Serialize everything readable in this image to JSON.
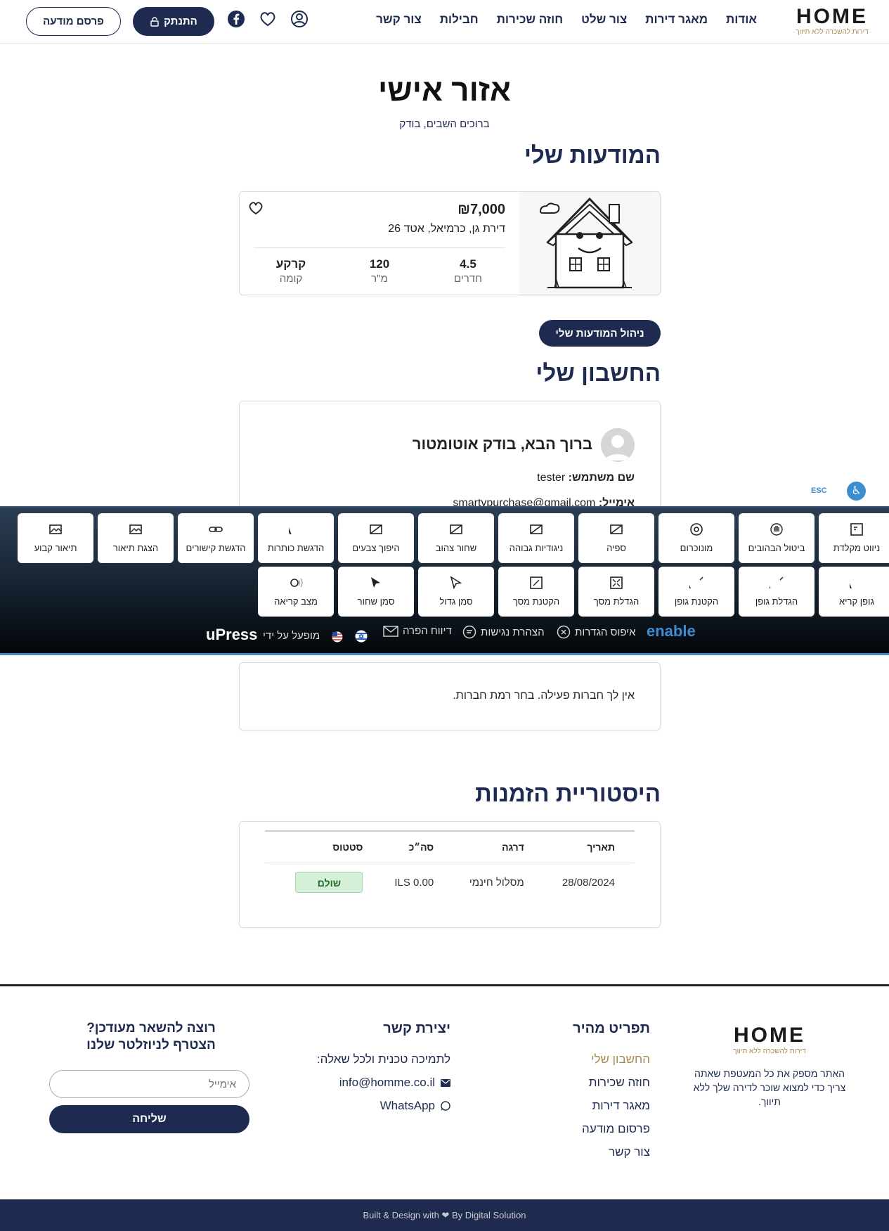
{
  "header": {
    "logo": "HOME",
    "logo_tagline": "דירות להשכרה ללא תיווך",
    "nav": [
      "אודות",
      "מאגר דירות",
      "צור שלט",
      "חוזה שכירות",
      "חבילות",
      "צור קשר"
    ],
    "login_label": "התנתק",
    "publish_label": "פרסם מודעה"
  },
  "page": {
    "title": "אזור אישי",
    "welcome": "ברוכים השבים, בודק"
  },
  "listings": {
    "title": "המודעות שלי",
    "item": {
      "price": "₪7,000",
      "address": "דירת גן, כרמיאל, אטד 26",
      "rooms_value": "4.5",
      "rooms_label": "חדרים",
      "size_value": "120",
      "size_label": "מ\"ר",
      "floor_value": "קרקע",
      "floor_label": "קומה"
    },
    "manage_label": "ניהול המודעות שלי"
  },
  "account": {
    "title": "החשבון שלי",
    "greeting": "ברוך הבא, בודק אוטומטור",
    "username_label": "שם משתמש:",
    "username": "tester",
    "email_label": "אימייל:",
    "email": "smartypurchase@gmail.com"
  },
  "membership": {
    "text": "אין לך חברות פעילה. בחר רמת חברות."
  },
  "orders": {
    "title": "היסטוריית הזמנות",
    "headers": [
      "תאריך",
      "דרגה",
      "סה״כ",
      "סטטוס"
    ],
    "rows": [
      {
        "date": "28/08/2024",
        "level": "מסלול חינמי",
        "total": "ILS 0.00",
        "status": "שולם"
      }
    ]
  },
  "accessibility": {
    "row1": [
      "ניווט מקלדת",
      "ביטול הבהובים",
      "מונוכרום",
      "ספיה",
      "ניגודיות גבוהה",
      "שחור צהוב",
      "היפוך צבעים",
      "הדגשת כותרות",
      "הדגשת קישורים",
      "הצגת תיאור",
      "תיאור קבוע"
    ],
    "row2": [
      "גופן קריא",
      "הגדלת גופן",
      "הקטנת גופן",
      "הגדלת מסך",
      "הקטנת מסך",
      "סמן גדול",
      "סמן שחור",
      "מצב קריאה"
    ],
    "brand": "enable",
    "reset": "איפוס הגדרות",
    "statement": "הצהרת נגישות",
    "report": "דיווח הפרה",
    "powered": "מופעל על ידי",
    "powered_brand": "uPress",
    "esc": "ESC"
  },
  "footer": {
    "logo": "HOME",
    "logo_tagline": "דירות להשכרה ללא תיווך",
    "about": "האתר מספק את כל המעטפת שאתה צריך כדי למצוא שוכר לדירה שלך ללא תיווך.",
    "quick_title": "תפריט מהיר",
    "quick_links": [
      "החשבון שלי",
      "חוזה שכירות",
      "מאגר דירות",
      "פרסום מודעה",
      "צור קשר"
    ],
    "contact_title": "יצירת קשר",
    "contact_support": "לתמיכה טכנית ולכל שאלה:",
    "contact_email": "info@homme.co.il",
    "contact_whatsapp": "WhatsApp",
    "newsletter_title_1": "רוצה להשאר מעודכן?",
    "newsletter_title_2": "הצטרף לניוזלטר שלנו",
    "newsletter_placeholder": "אימייל",
    "newsletter_button": "שליחה",
    "credit": "Built & Design with ❤ By Digital Solution"
  },
  "colors": {
    "navy": "#1e2a4f",
    "gold": "#a88a4e",
    "accent_blue": "#3d8ed0",
    "paid_green": "#d6f0d8"
  }
}
